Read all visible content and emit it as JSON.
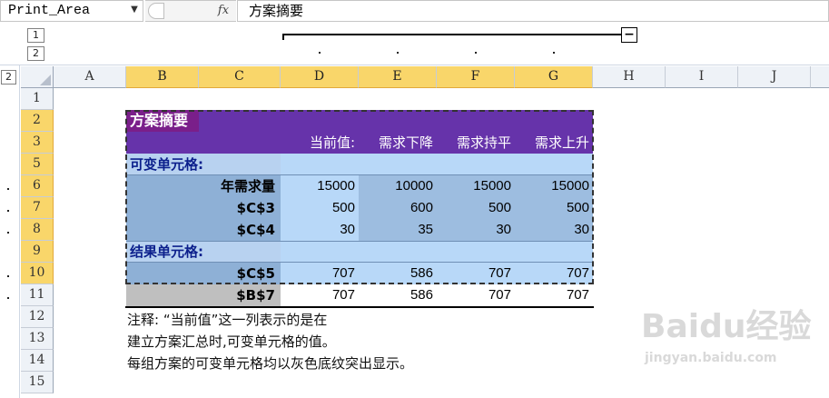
{
  "formula_bar": {
    "name_box": "Print_Area",
    "fx_label": "fx",
    "content": "方案摘要"
  },
  "outline": {
    "levels": [
      "1",
      "2"
    ],
    "row_level": "2",
    "collapse_symbol": "−"
  },
  "columns": [
    "A",
    "B",
    "C",
    "D",
    "E",
    "F",
    "G",
    "H",
    "I",
    "J"
  ],
  "rows": [
    "1",
    "2",
    "3",
    "5",
    "6",
    "7",
    "8",
    "9",
    "10",
    "11",
    "12",
    "13",
    "14",
    "15"
  ],
  "summary": {
    "title": "方案摘要",
    "headers": [
      "当前值:",
      "需求下降",
      "需求持平",
      "需求上升"
    ],
    "changing_section": "可变单元格:",
    "changing_rows": [
      {
        "label": "年需求量",
        "values": [
          "15000",
          "10000",
          "15000",
          "15000"
        ]
      },
      {
        "label": "$C$3",
        "values": [
          "500",
          "600",
          "500",
          "500"
        ]
      },
      {
        "label": "$C$4",
        "values": [
          "30",
          "35",
          "30",
          "30"
        ]
      }
    ],
    "result_section": "结果单元格:",
    "result_rows": [
      {
        "label": "$C$5",
        "values": [
          "707",
          "586",
          "707",
          "707"
        ]
      },
      {
        "label": "$B$7",
        "values": [
          "707",
          "586",
          "707",
          "707"
        ]
      }
    ]
  },
  "notes": [
    "注释: “当前值”这一列表示的是在",
    "建立方案汇总时,可变单元格的值。",
    "每组方案的可变单元格均以灰色底纹突出显示。"
  ],
  "watermark": {
    "main": "Baidu经验",
    "sub": "jingyan.baidu.com"
  },
  "colors": {
    "title_bg": "#7030a0",
    "header_bg": "#6633aa",
    "section_bg": "#b8d2f0",
    "label_bg": "#8eb0d6",
    "current_bg": "#b8d8f8",
    "scenario_bg": "#9dbde0",
    "selected_header": "#f9d66a",
    "gray_label": "#bfbfbf"
  }
}
